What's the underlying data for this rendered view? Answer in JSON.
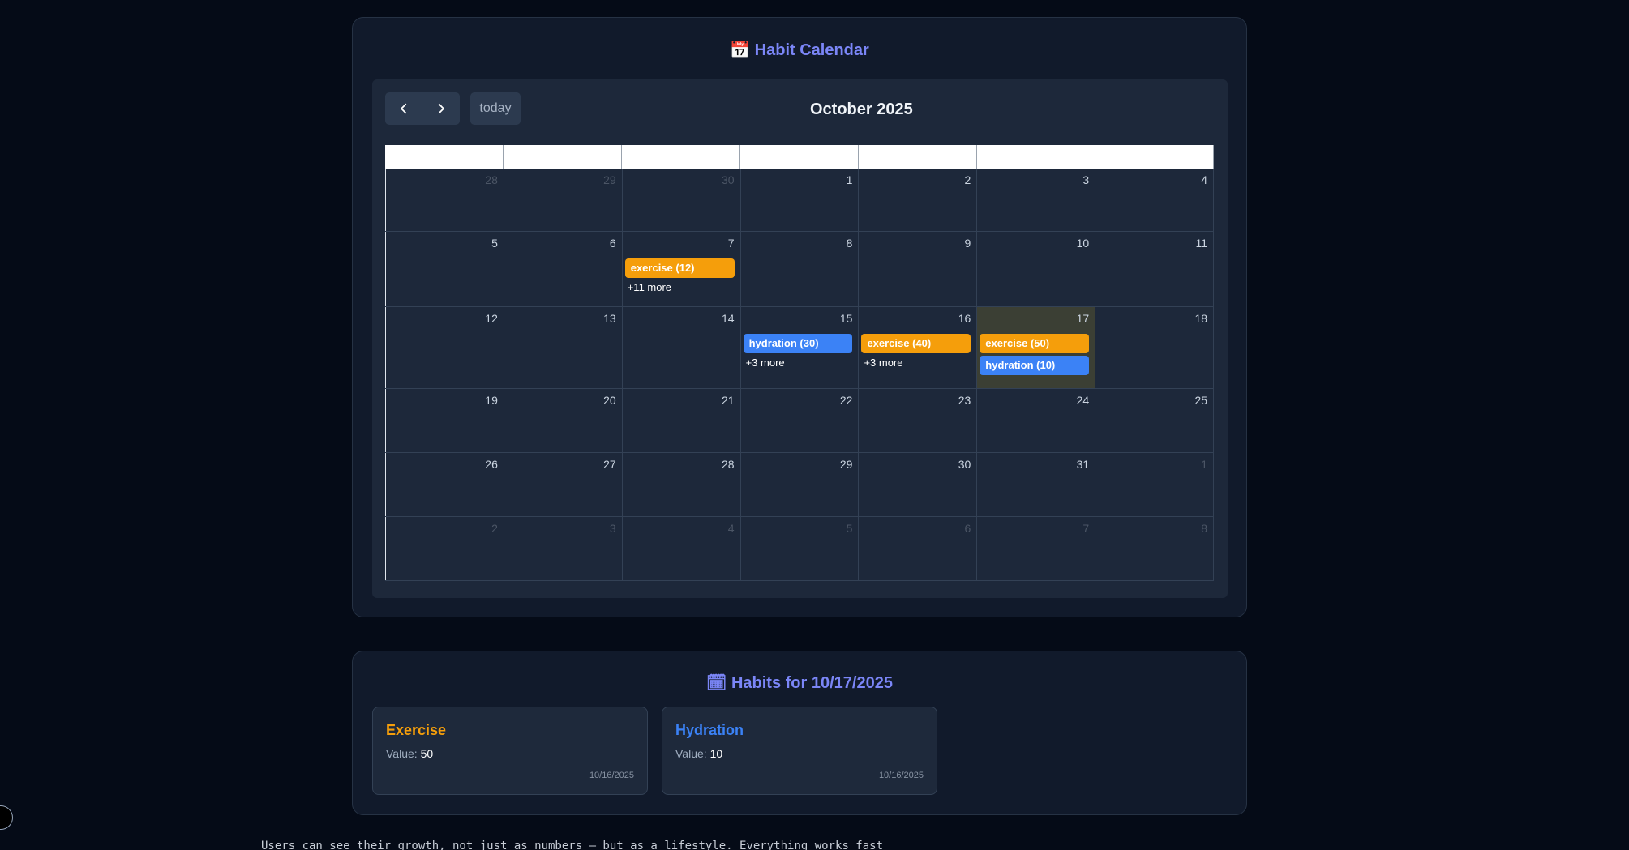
{
  "calendar": {
    "title_icon": "📅",
    "title": "Habit Calendar",
    "prev_icon": "chevron-left-icon",
    "next_icon": "chevron-right-icon",
    "today_label": "today",
    "month_title": "October 2025",
    "weeks": [
      [
        {
          "d": "28",
          "o": true
        },
        {
          "d": "29",
          "o": true
        },
        {
          "d": "30",
          "o": true
        },
        {
          "d": "1"
        },
        {
          "d": "2"
        },
        {
          "d": "3"
        },
        {
          "d": "4"
        }
      ],
      [
        {
          "d": "5"
        },
        {
          "d": "6"
        },
        {
          "d": "7",
          "events": [
            {
              "label": "exercise (12)",
              "color": "orange"
            }
          ],
          "more": "+11 more"
        },
        {
          "d": "8"
        },
        {
          "d": "9"
        },
        {
          "d": "10"
        },
        {
          "d": "11"
        }
      ],
      [
        {
          "d": "12"
        },
        {
          "d": "13"
        },
        {
          "d": "14"
        },
        {
          "d": "15",
          "events": [
            {
              "label": "hydration (30)",
              "color": "blue"
            }
          ],
          "more": "+3 more"
        },
        {
          "d": "16",
          "events": [
            {
              "label": "exercise (40)",
              "color": "orange"
            }
          ],
          "more": "+3 more"
        },
        {
          "d": "17",
          "today": true,
          "events": [
            {
              "label": "exercise (50)",
              "color": "orange"
            },
            {
              "label": "hydration (10)",
              "color": "blue"
            }
          ]
        },
        {
          "d": "18"
        }
      ],
      [
        {
          "d": "19"
        },
        {
          "d": "20"
        },
        {
          "d": "21"
        },
        {
          "d": "22"
        },
        {
          "d": "23"
        },
        {
          "d": "24"
        },
        {
          "d": "25"
        }
      ],
      [
        {
          "d": "26"
        },
        {
          "d": "27"
        },
        {
          "d": "28"
        },
        {
          "d": "29"
        },
        {
          "d": "30"
        },
        {
          "d": "31"
        },
        {
          "d": "1",
          "o": true
        }
      ],
      [
        {
          "d": "2",
          "o": true
        },
        {
          "d": "3",
          "o": true
        },
        {
          "d": "4",
          "o": true
        },
        {
          "d": "5",
          "o": true
        },
        {
          "d": "6",
          "o": true
        },
        {
          "d": "7",
          "o": true
        },
        {
          "d": "8",
          "o": true
        }
      ]
    ]
  },
  "habits": {
    "title_icon": "🗓",
    "title": "Habits for 10/17/2025",
    "value_label": "Value:",
    "cards": [
      {
        "name": "Exercise",
        "value": "50",
        "date": "10/16/2025",
        "color": "#f59e0b"
      },
      {
        "name": "Hydration",
        "value": "10",
        "date": "10/16/2025",
        "color": "#3b82f6"
      }
    ]
  },
  "footer_text": "Users can see their growth, not just as numbers — but as a lifestyle. Everything works fast"
}
